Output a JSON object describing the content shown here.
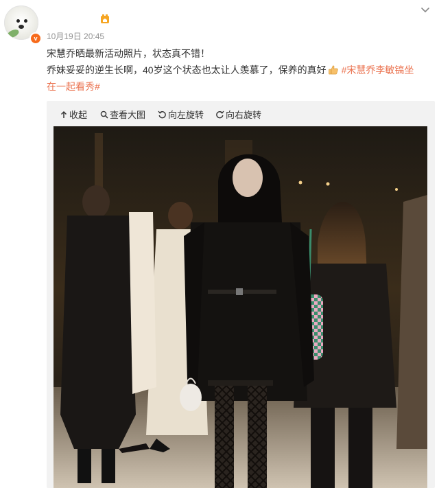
{
  "post": {
    "timestamp": "10月19日 20:45",
    "line1": "宋慧乔晒最新活动照片，状态真不错！",
    "line2": "乔妹妥妥的逆生长啊，40岁这个状态也太让人羡慕了，保养的真好",
    "hashtag_part1": "#宋慧乔李敏镐坐",
    "hashtag_part2": "在一起看秀#"
  },
  "media_toolbar": {
    "collapse": "收起",
    "view_large": "查看大图",
    "rotate_left": "向左旋转",
    "rotate_right": "向右旋转"
  },
  "colors": {
    "hashtag": "#eb7350",
    "toolbar_bg": "#f2f2f2",
    "timestamp": "#939393"
  },
  "icons": [
    "avatar",
    "verified-badge-icon",
    "crown-icon",
    "chevron-down-icon",
    "thumbs-up-emoji-icon",
    "arrow-up-icon",
    "magnifier-icon",
    "rotate-left-icon",
    "rotate-right-icon"
  ]
}
